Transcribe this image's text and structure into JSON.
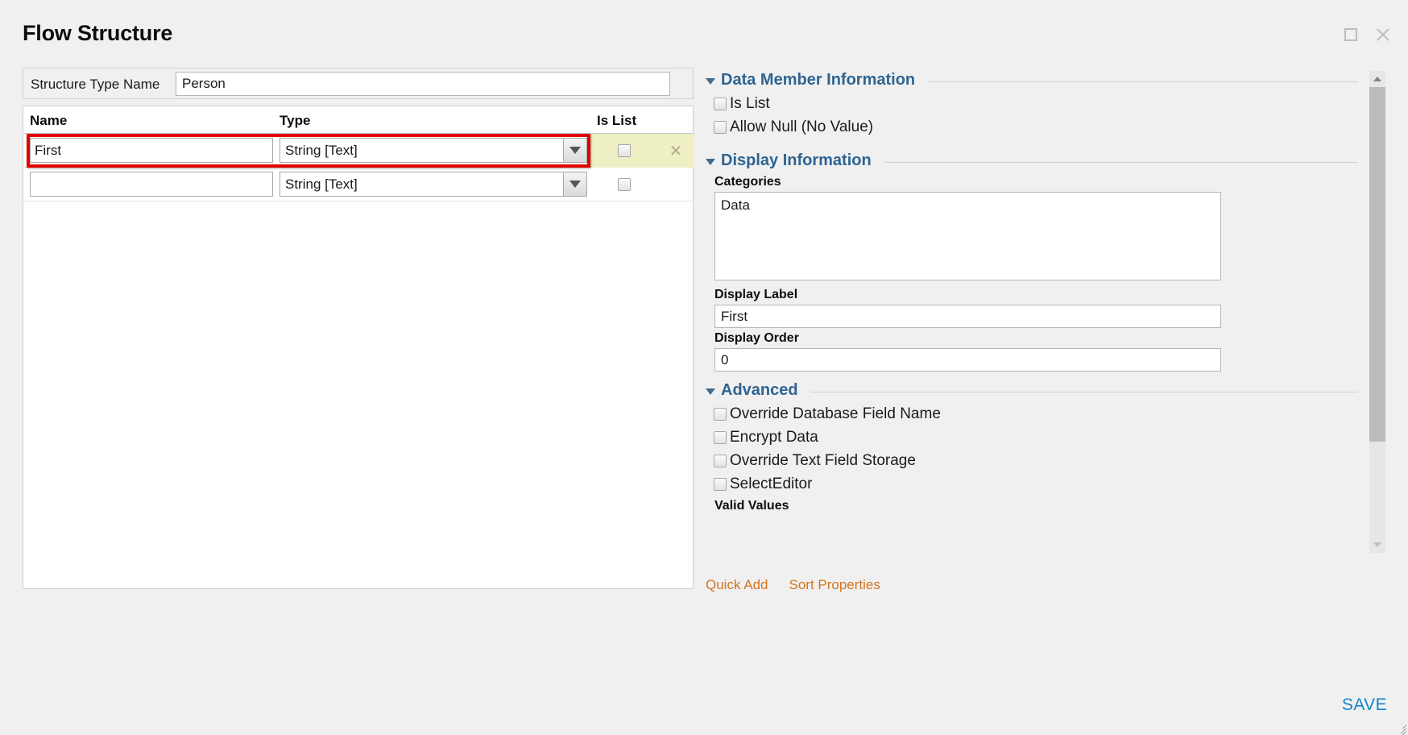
{
  "window": {
    "title": "Flow Structure",
    "maximize_icon": "maximize-icon",
    "close_icon": "close-icon"
  },
  "structure": {
    "type_name_label": "Structure Type Name",
    "type_name_value": "Person"
  },
  "grid": {
    "columns": [
      "Name",
      "Type",
      "Is List"
    ],
    "rows": [
      {
        "name": "First",
        "type": "String [Text]",
        "is_list": false,
        "selected": true,
        "delete_icon": "close-x-icon"
      },
      {
        "name": "",
        "type": "String [Text]",
        "is_list": false,
        "selected": false,
        "delete_icon": "close-x-icon"
      }
    ]
  },
  "properties": {
    "data_member_information": {
      "title": "Data Member Information",
      "caret_icon": "caret-down-icon",
      "checkboxes": [
        {
          "label": "Is List",
          "checked": false
        },
        {
          "label": "Allow Null (No Value)",
          "checked": false
        }
      ]
    },
    "display_information": {
      "title": "Display Information",
      "caret_icon": "caret-down-icon",
      "categories_label": "Categories",
      "categories_value": "Data",
      "display_label_label": "Display Label",
      "display_label_value": "First",
      "display_order_label": "Display Order",
      "display_order_value": "0"
    },
    "advanced": {
      "title": "Advanced",
      "caret_icon": "caret-down-icon",
      "checkboxes": [
        {
          "label": "Override Database Field Name",
          "checked": false
        },
        {
          "label": "Encrypt Data",
          "checked": false
        },
        {
          "label": "Override Text Field Storage",
          "checked": false
        },
        {
          "label": "SelectEditor",
          "checked": false
        }
      ],
      "valid_values_label": "Valid Values"
    }
  },
  "footer": {
    "quick_add": "Quick Add",
    "sort_properties": "Sort Properties",
    "save": "SAVE"
  },
  "colors": {
    "accent_blue": "#2e6491",
    "save_blue": "#1286c9",
    "link_orange": "#d2751f",
    "highlight_red": "#e00000",
    "row_yellow": "#efefc4"
  }
}
